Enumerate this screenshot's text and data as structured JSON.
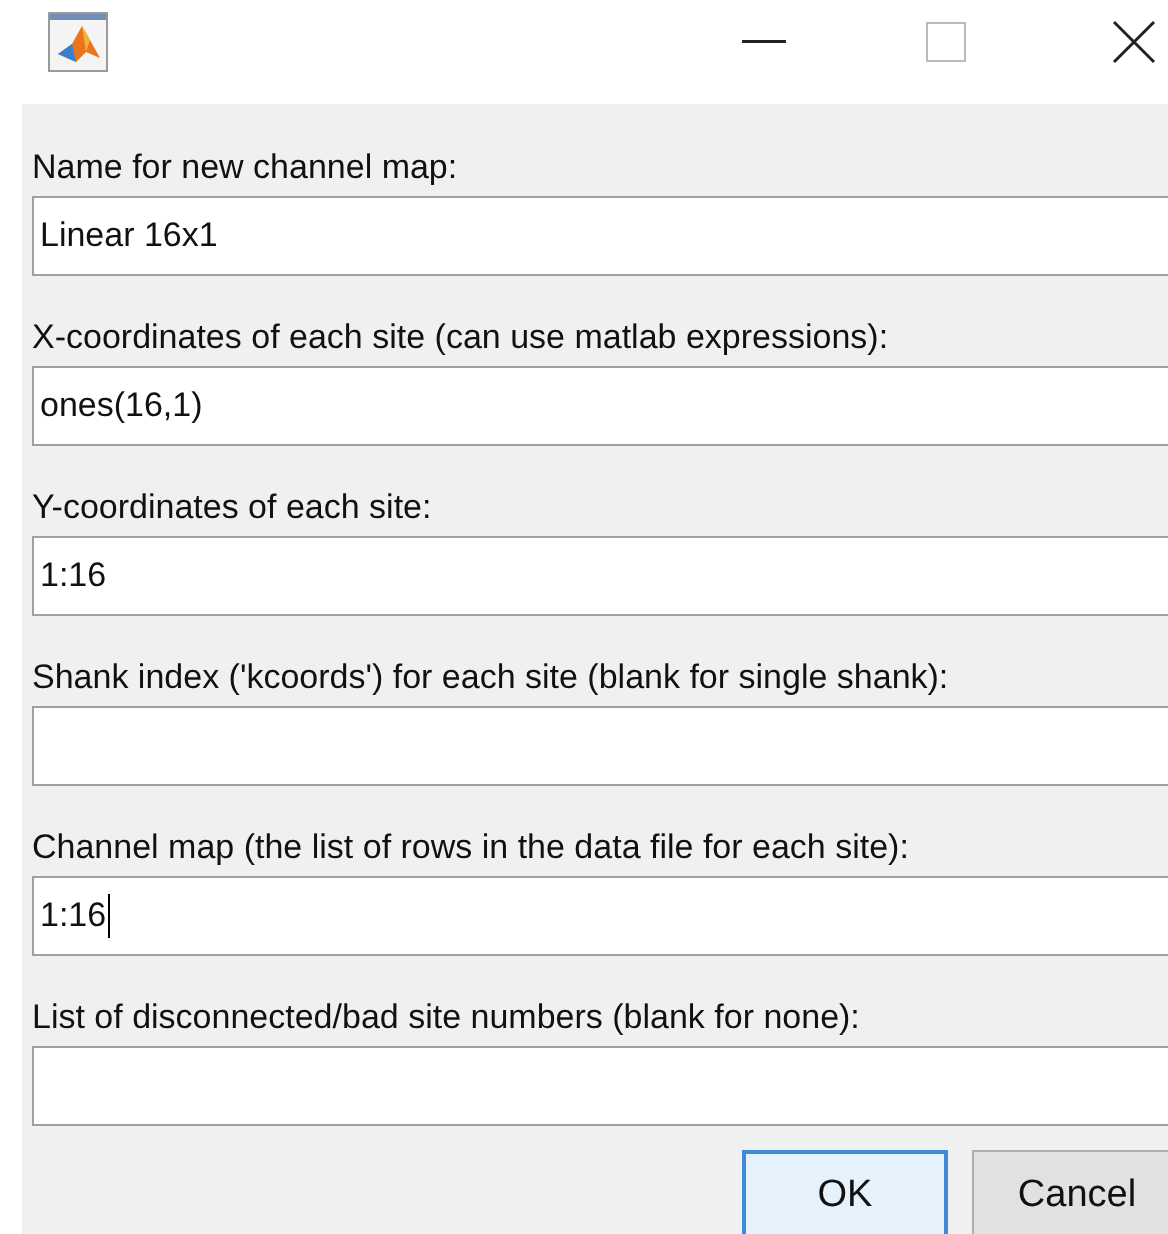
{
  "fields": [
    {
      "label": "Name for new channel map:",
      "value": "Linear 16x1",
      "focused": false
    },
    {
      "label": "X-coordinates of each site (can use matlab expressions):",
      "value": "ones(16,1)",
      "focused": false
    },
    {
      "label": "Y-coordinates of each site:",
      "value": "1:16",
      "focused": false
    },
    {
      "label": "Shank index ('kcoords') for each site (blank for single shank):",
      "focused": false
    },
    {
      "label": "Channel map (the list of rows in the data file for each site):",
      "value": "1:16",
      "focused": true
    },
    {
      "label": "List of disconnected/bad site numbers (blank for none):",
      "focused": false
    }
  ],
  "buttons": [
    {
      "label": "OK",
      "default": true
    },
    {
      "label": "Cancel",
      "default": false
    }
  ]
}
